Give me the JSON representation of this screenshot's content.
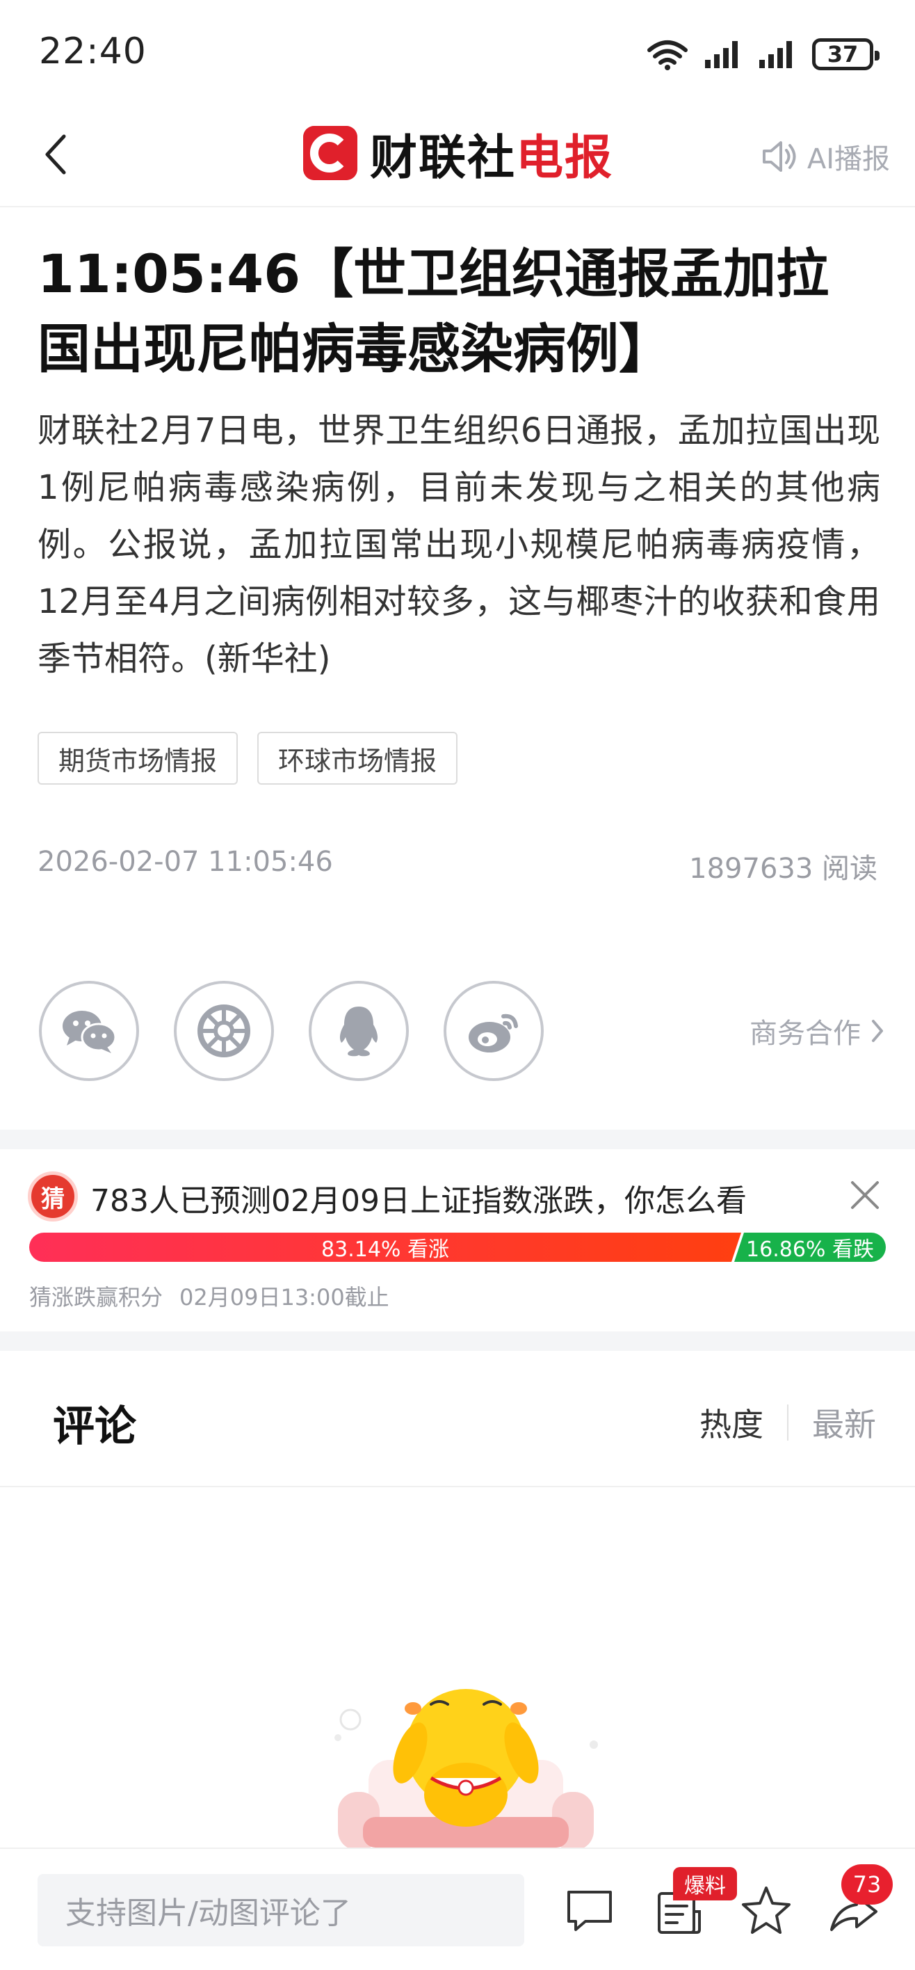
{
  "status_bar": {
    "time": "22:40",
    "battery": "37"
  },
  "header": {
    "logo_text_1": "财联社",
    "logo_text_2": "电报",
    "ai_play_label": "AI播报"
  },
  "article": {
    "headline": "11:05:46【世卫组织通报孟加拉国出现尼帕病毒感染病例】",
    "body": "财联社2月7日电，世界卫生组织6日通报，孟加拉国出现1例尼帕病毒感染病例，目前未发现与之相关的其他病例。公报说，孟加拉国常出现小规模尼帕病毒病疫情，12月至4月之间病例相对较多，这与椰枣汁的收获和食用季节相符。(新华社)",
    "tags": [
      "期货市场情报",
      "环球市场情报"
    ],
    "datetime": "2026-02-07 11:05:46",
    "reads": "1897633 阅读"
  },
  "share": {
    "business_label": "商务合作"
  },
  "prediction": {
    "badge": "猜",
    "question": "783人已预测02月09日上证指数涨跌，你怎么看",
    "up_label": "83.14% 看涨",
    "down_label": "16.86% 看跌",
    "up_fraction": 0.8314,
    "footer_left": "猜涨跌赢积分",
    "footer_right": "02月09日13:00截止",
    "colors": {
      "up": "#ff3f10",
      "down": "#17b24a"
    }
  },
  "comments": {
    "title": "评论",
    "sort_hot": "热度",
    "sort_new": "最新"
  },
  "bottom_bar": {
    "input_placeholder": "支持图片/动图评论了",
    "bao_badge": "爆料",
    "share_count": "73",
    "icons": [
      "comment-icon",
      "report-icon",
      "star-icon",
      "share-icon"
    ]
  },
  "colors": {
    "brand_red": "#e0202b"
  }
}
